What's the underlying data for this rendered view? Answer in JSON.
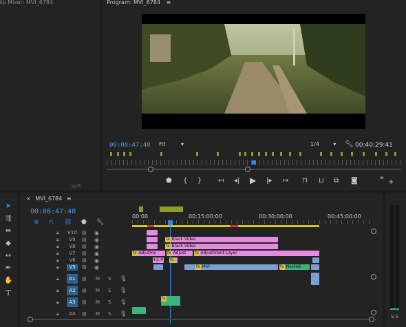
{
  "left_panel": {
    "title": "lip Mixer: MVI_6784"
  },
  "program": {
    "title": "Program: MVI_6784",
    "menu_icon": "hamburger-icon",
    "timecode_current": "00:08:47:48",
    "fit_label": "Fit",
    "resolution": "1/4",
    "timecode_total": "00:40:29:41",
    "controls": [
      "add-marker",
      "mark-in",
      "mark-out",
      "go-to-in",
      "step-back",
      "play",
      "step-forward",
      "go-to-out",
      "lift",
      "extract",
      "insert",
      "export-frame",
      "more",
      "add"
    ]
  },
  "timeline": {
    "tab_title": "MVI_6784",
    "timecode": "00:08:47:48",
    "ruler": [
      "00:00",
      "00:15:00:00",
      "00:30:00:00",
      "00:45:00:00"
    ],
    "video_tracks": [
      "V10",
      "V9",
      "V8",
      "V7",
      "V6",
      "V5"
    ],
    "audio_tracks": [
      "A1",
      "A2",
      "A3",
      "A4"
    ],
    "audio_btn_m": "M",
    "audio_btn_s": "S",
    "clips": {
      "black_video_1": "Black Video",
      "black_video_2": "Black Video",
      "adjustment_1": "Adjutme",
      "adjustment_2": "Adjust",
      "adjustment_3": "Adjustment Layer",
      "v6_label": "+2.4",
      "mvi": "MVI",
      "nested": "Nested"
    }
  },
  "meters": {
    "label": "S S"
  },
  "colors": {
    "timecode": "#4a9be0",
    "clip_pink": "#e38be0",
    "clip_blue": "#7aa0d6",
    "clip_green": "#3bb37a",
    "accent_blue": "#2d8ceb"
  }
}
